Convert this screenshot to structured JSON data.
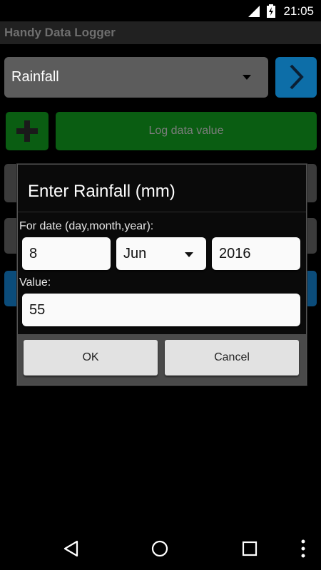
{
  "status": {
    "time": "21:05"
  },
  "app": {
    "title": "Handy Data Logger"
  },
  "main": {
    "dataset": "Rainfall",
    "log_button": "Log data value"
  },
  "dialog": {
    "title": "Enter Rainfall (mm)",
    "date_label": "For date (day,month,year):",
    "day": "8",
    "month": "Jun",
    "year": "2016",
    "value_label": "Value:",
    "value": "55",
    "ok": "OK",
    "cancel": "Cancel"
  },
  "colors": {
    "appbar": "#212121",
    "log_green": "#0a5d12",
    "nav_blue": "#0d6ea8",
    "dialog_bg": "#0a0a0a"
  },
  "icons": [
    "signal-icon",
    "battery-icon",
    "chevron-right-icon",
    "plus-icon",
    "back-icon",
    "home-icon",
    "recents-icon",
    "overflow-menu-icon"
  ]
}
